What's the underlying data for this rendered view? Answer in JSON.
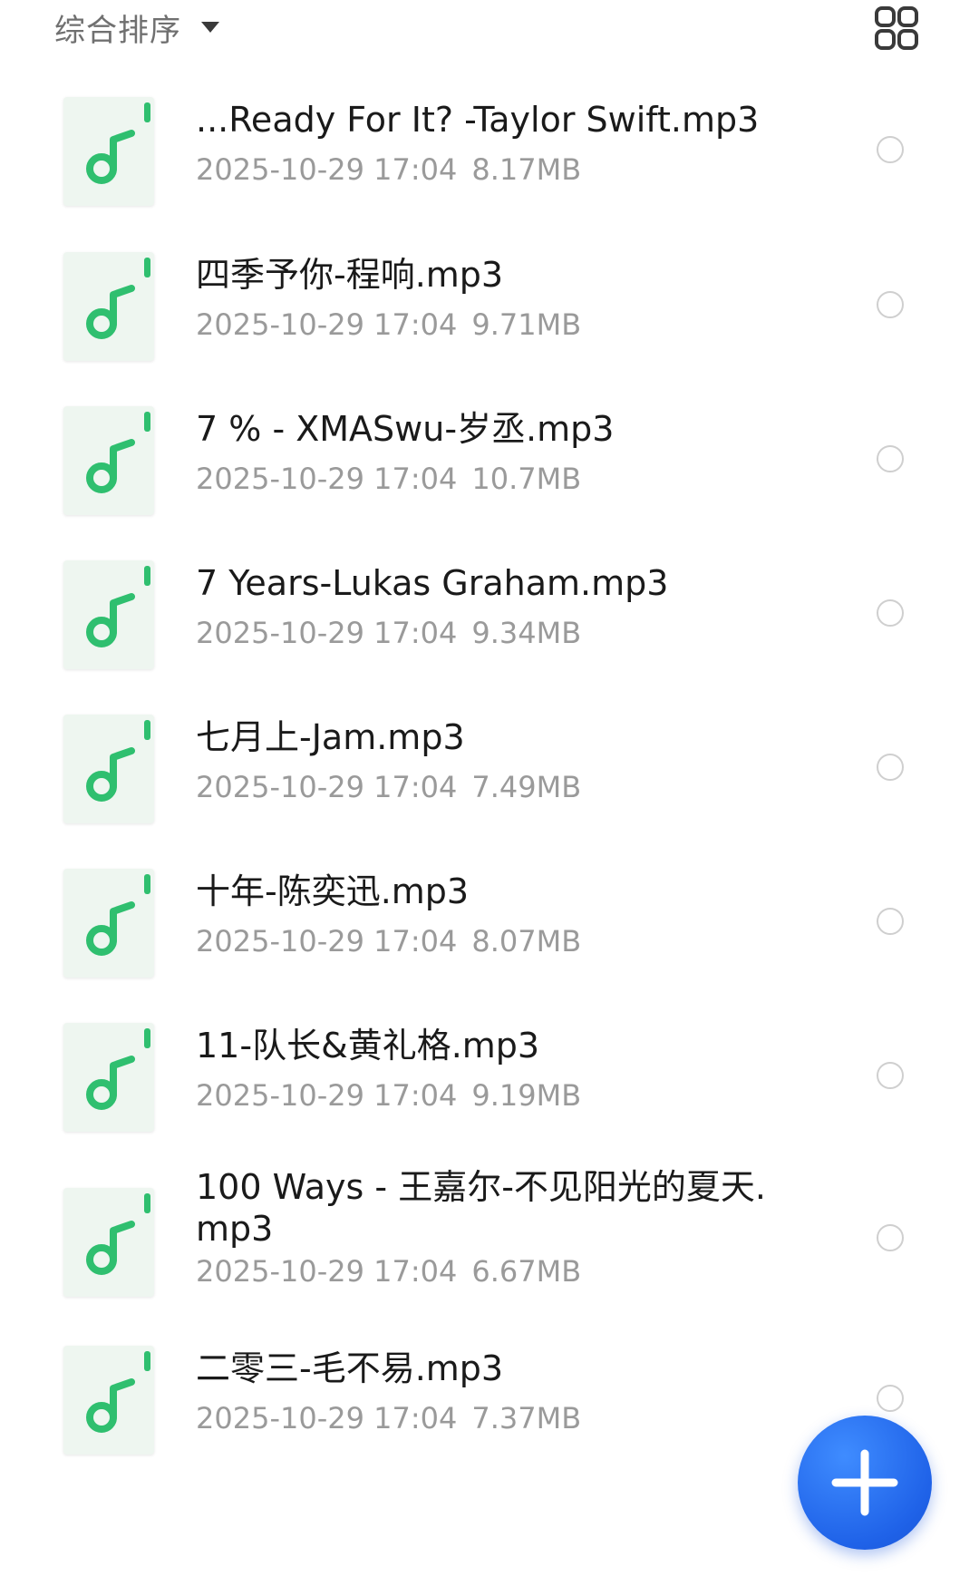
{
  "sort": {
    "label": "综合排序"
  },
  "view_toggle": {
    "icon": "grid-view-icon"
  },
  "files": [
    {
      "name": "...Ready For It?  -Taylor Swift.mp3",
      "date": "2025-10-29 17:04",
      "size": "8.17MB"
    },
    {
      "name": "四季予你-程响.mp3",
      "date": "2025-10-29 17:04",
      "size": "9.71MB"
    },
    {
      "name": "7 % - XMASwu-岁丞.mp3",
      "date": "2025-10-29 17:04",
      "size": "10.7MB"
    },
    {
      "name": "7 Years-Lukas Graham.mp3",
      "date": "2025-10-29 17:04",
      "size": "9.34MB"
    },
    {
      "name": "七月上-Jam.mp3",
      "date": "2025-10-29 17:04",
      "size": "7.49MB"
    },
    {
      "name": "十年-陈奕迅.mp3",
      "date": "2025-10-29 17:04",
      "size": "8.07MB"
    },
    {
      "name": "11-队长&黄礼格.mp3",
      "date": "2025-10-29 17:04",
      "size": "9.19MB"
    },
    {
      "name": "100 Ways - 王嘉尔-不见阳光的夏天.\nmp3",
      "date": "2025-10-29 17:04",
      "size": "6.67MB"
    },
    {
      "name": "二零三-毛不易.mp3",
      "date": "2025-10-29 17:04",
      "size": "7.37MB"
    }
  ],
  "fab": {
    "icon": "plus-icon"
  },
  "colors": {
    "accent_green": "#2fbf6f",
    "fab_blue": "#2468f0",
    "meta_gray": "#9a9a9a"
  }
}
